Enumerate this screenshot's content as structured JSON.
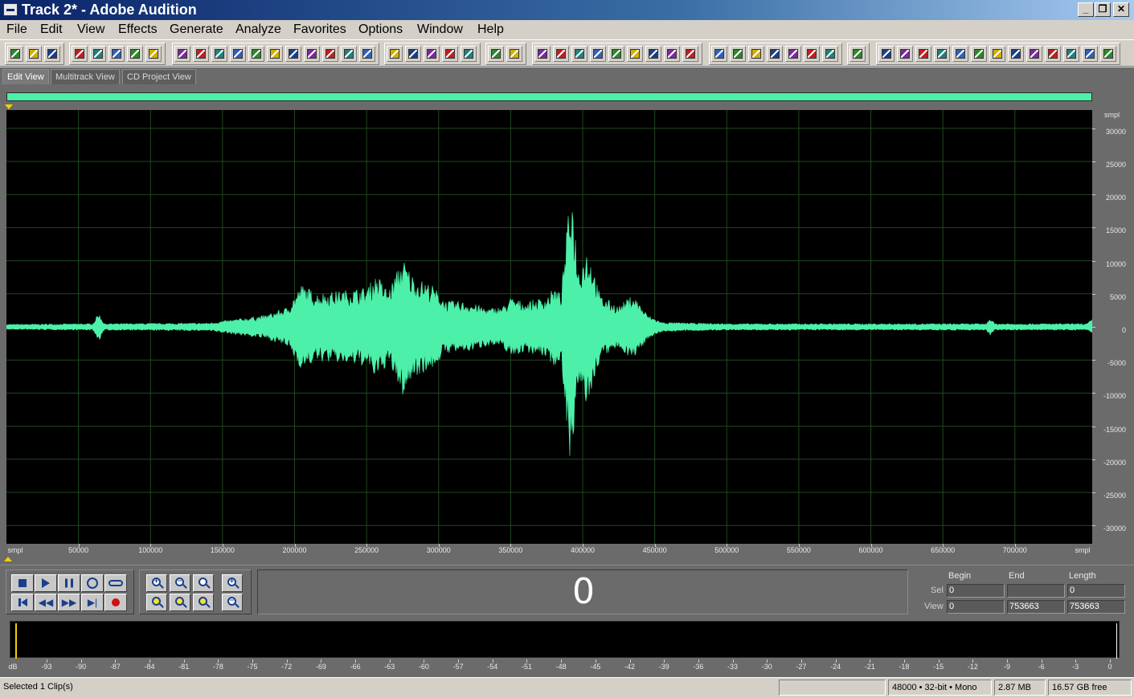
{
  "window": {
    "title": "Track 2* - Adobe Audition",
    "minimize": "_",
    "restore": "❐",
    "close": "✕"
  },
  "menu": [
    "File",
    "Edit",
    "View",
    "Effects",
    "Generate",
    "Analyze",
    "Favorites",
    "Options",
    "Window",
    "Help"
  ],
  "view_tabs": [
    {
      "label": "Edit View",
      "active": true
    },
    {
      "label": "Multitrack View",
      "active": false
    },
    {
      "label": "CD Project View",
      "active": false
    }
  ],
  "waveform": {
    "color": "#4df0a8",
    "background": "#000000",
    "grid_color": "#1f4a1f",
    "total_samples": 753663,
    "amplitude_range": [
      -32768,
      32768
    ],
    "time_unit": "smpl",
    "amp_unit": "smpl",
    "time_ticks": [
      50000,
      100000,
      150000,
      200000,
      250000,
      300000,
      350000,
      400000,
      450000,
      500000,
      550000,
      600000,
      650000,
      700000
    ],
    "amp_ticks": [
      30000,
      25000,
      20000,
      15000,
      10000,
      5000,
      0,
      -5000,
      -10000,
      -15000,
      -20000,
      -25000,
      -30000
    ],
    "envelope": [
      [
        0,
        400
      ],
      [
        60000,
        500
      ],
      [
        64000,
        2200
      ],
      [
        68000,
        500
      ],
      [
        140000,
        600
      ],
      [
        160000,
        1200
      ],
      [
        180000,
        1800
      ],
      [
        195000,
        3000
      ],
      [
        205000,
        6500
      ],
      [
        215000,
        5200
      ],
      [
        230000,
        5500
      ],
      [
        250000,
        6000
      ],
      [
        257000,
        8000
      ],
      [
        265000,
        5500
      ],
      [
        275000,
        10500
      ],
      [
        283000,
        7500
      ],
      [
        295000,
        6500
      ],
      [
        305000,
        4000
      ],
      [
        320000,
        3800
      ],
      [
        335000,
        2800
      ],
      [
        345000,
        3200
      ],
      [
        350000,
        4500
      ],
      [
        360000,
        3800
      ],
      [
        375000,
        4600
      ],
      [
        380000,
        6000
      ],
      [
        385000,
        5000
      ],
      [
        392000,
        22000
      ],
      [
        397000,
        9000
      ],
      [
        403000,
        12000
      ],
      [
        407000,
        9500
      ],
      [
        412000,
        4800
      ],
      [
        425000,
        3200
      ],
      [
        435000,
        5000
      ],
      [
        445000,
        1800
      ],
      [
        455000,
        700
      ],
      [
        500000,
        500
      ],
      [
        680000,
        500
      ],
      [
        683000,
        1500
      ],
      [
        686000,
        500
      ],
      [
        750000,
        500
      ],
      [
        753663,
        1200
      ]
    ]
  },
  "transport": {
    "time_display": "0"
  },
  "selection_view": {
    "headers": {
      "begin": "Begin",
      "end": "End",
      "length": "Length"
    },
    "sel": {
      "label": "Sel",
      "begin": "0",
      "end": "",
      "length": "0"
    },
    "view": {
      "label": "View",
      "begin": "0",
      "end": "753663",
      "length": "753663"
    }
  },
  "meter": {
    "unit": "dB",
    "ticks": [
      "-93",
      "-90",
      "-87",
      "-84",
      "-81",
      "-78",
      "-75",
      "-72",
      "-69",
      "-66",
      "-63",
      "-60",
      "-57",
      "-54",
      "-51",
      "-48",
      "-45",
      "-42",
      "-39",
      "-36",
      "-33",
      "-30",
      "-27",
      "-24",
      "-21",
      "-18",
      "-15",
      "-12",
      "-9",
      "-6",
      "-3",
      "0"
    ]
  },
  "status": {
    "message": "Selected 1 Clip(s)",
    "format": "48000 • 32-bit • Mono",
    "size": "2.87 MB",
    "free": "16.57 GB free"
  },
  "toolbar_icons": [
    "waveform-icon",
    "multitrack-icon",
    "cd-icon",
    "new-icon",
    "open-icon",
    "save-icon",
    "save-as-icon",
    "save-all-icon",
    "undo-icon",
    "redo-icon",
    "cut-icon",
    "copy-icon",
    "paste-icon",
    "trim-icon",
    "mix-paste-icon",
    "insert-icon",
    "insert-multitrack-icon",
    "import-icon",
    "amplify-icon",
    "normalize-icon",
    "invert-icon",
    "reverse-icon",
    "silence-icon",
    "time-selection-icon",
    "marquee-icon",
    "spectral-icon",
    "snap-icon",
    "cue-list-icon",
    "play-list-icon",
    "scrub-icon",
    "zoom-tool-icon",
    "time-format-icon",
    "grid-icon",
    "meter-icon",
    "info-icon",
    "effect-1-icon",
    "effect-2-icon",
    "effect-3-icon",
    "effect-4-icon",
    "effect-5-icon",
    "effect-6-icon",
    "effect-7-icon",
    "frequency-icon",
    "analysis-1-icon",
    "analysis-2-icon",
    "analysis-3-icon",
    "analysis-4-icon",
    "analysis-5-icon",
    "analysis-6-icon",
    "analysis-7-icon",
    "analysis-8-icon",
    "analysis-9-icon",
    "analysis-10-icon",
    "analysis-11-icon",
    "itu-p56-icon",
    "sti-icon",
    "final-icon"
  ]
}
